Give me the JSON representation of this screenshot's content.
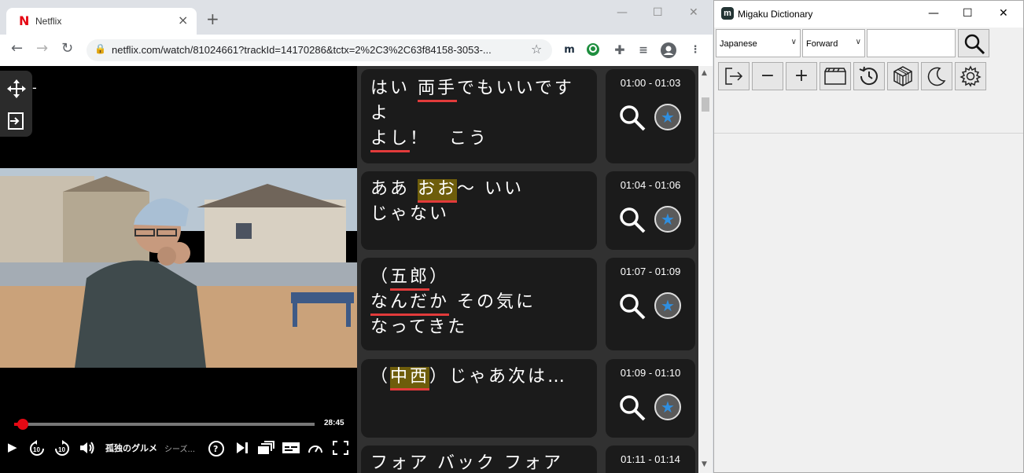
{
  "browser": {
    "tab_title": "Netflix",
    "tab_close": "×",
    "new_tab": "+",
    "url": "netflix.com/watch/81024661?trackId=14170286&tctx=2%2C3%2C63f84158-3053-...",
    "win_min": "—",
    "win_max": "☐",
    "win_close": "✕"
  },
  "player": {
    "elapsed_fraction": 0.03,
    "time_remaining": "28:45",
    "show_title": "孤独のグルメ",
    "episode_hint": "シーズ...",
    "overlay_dash": "-"
  },
  "subtitles": [
    {
      "time": "01:00 - 01:03"
    },
    {
      "time": "01:04 - 01:06"
    },
    {
      "time": "01:07 - 01:09"
    },
    {
      "time": "01:09 - 01:10"
    },
    {
      "time": "01:11 - 01:14"
    }
  ],
  "dictionary": {
    "title": "Migaku Dictionary",
    "language": "Japanese",
    "direction": "Forward",
    "search_value": "",
    "win_min": "—",
    "win_max": "☐",
    "win_close": "✕"
  },
  "colors": {
    "netflix_red": "#e50914",
    "underline_red": "#e23b3b",
    "highlight_gold": "#6e5d0b",
    "card_bg": "#1b1b1b"
  }
}
